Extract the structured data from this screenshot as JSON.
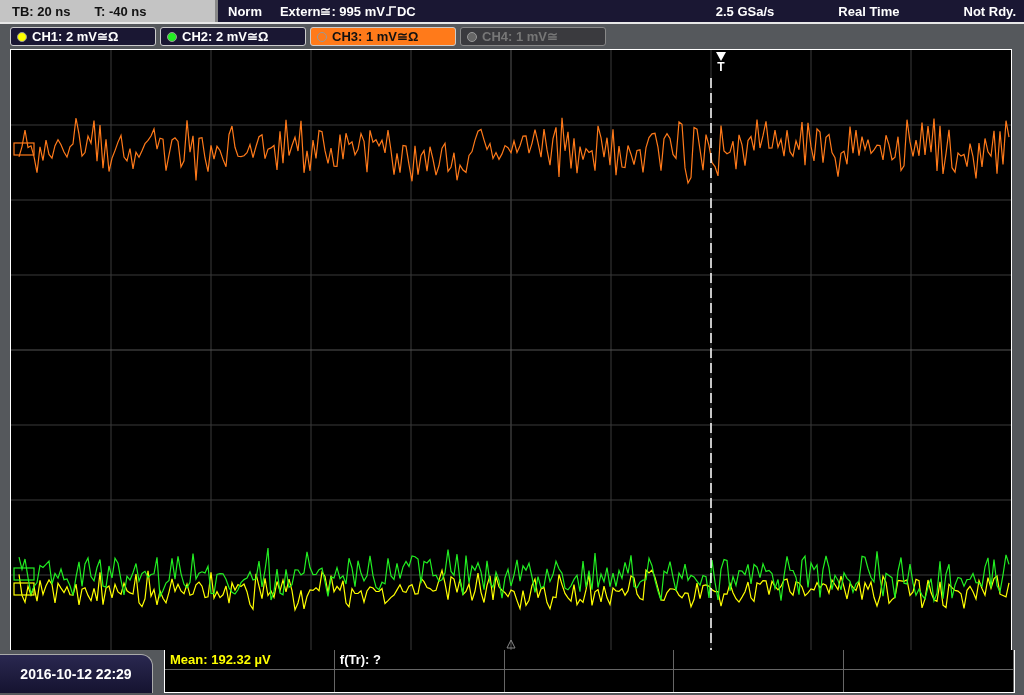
{
  "top_bar": {
    "timebase": "TB: 20 ns",
    "trigger_time": "T: -40 ns",
    "mode": "Norm",
    "trigger_source": "Extern≅: 995 mV",
    "rising_edge": true,
    "coupling": "DC",
    "sample_rate": "2.5 GSa/s",
    "acquisition": "Real Time",
    "status": "Not Rdy."
  },
  "channels": [
    {
      "label": "CH1: 2 mV≅Ω",
      "color": "#ffff00",
      "on": true,
      "selected": false
    },
    {
      "label": "CH2: 2 mV≅Ω",
      "color": "#22ee22",
      "on": true,
      "selected": false
    },
    {
      "label": "CH3: 1 mV≅Ω",
      "color": "#ff7a1a",
      "on": true,
      "selected": true
    },
    {
      "label": "CH4: 1 mV≅",
      "color": "#666666",
      "on": false,
      "selected": false
    }
  ],
  "screen": {
    "trigger_marker": "T"
  },
  "date_time": "2016-10-12 22:29",
  "measurements": [
    {
      "text": "Mean: 192.32 µV",
      "color": "#ffff00"
    },
    {
      "text": "f(Tr): ?",
      "color": "#ffffff"
    }
  ]
}
